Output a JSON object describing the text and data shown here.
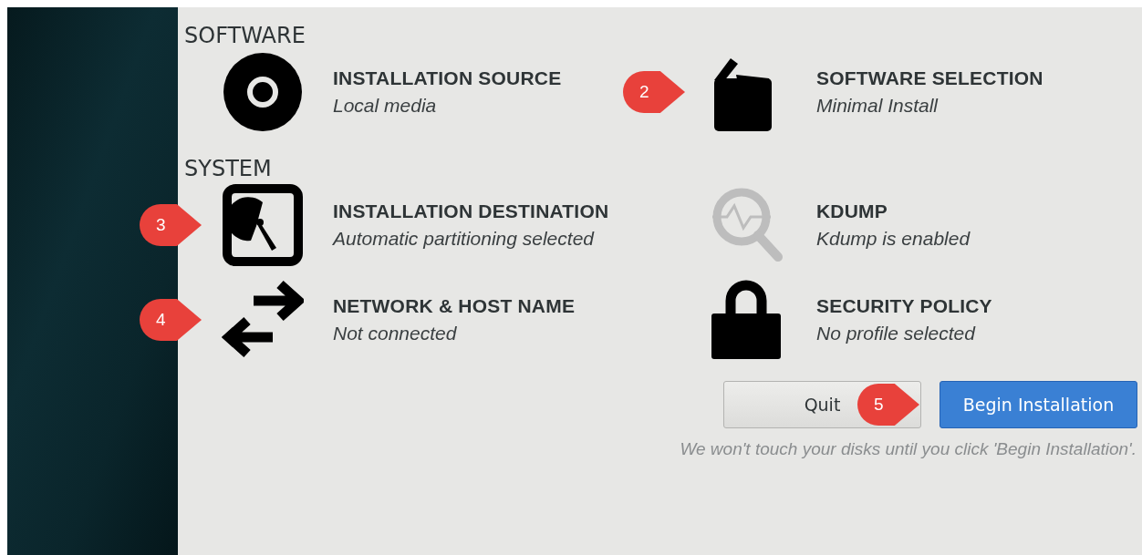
{
  "sections": [
    {
      "heading": "SOFTWARE",
      "spokes": [
        {
          "kind": "disc",
          "title": "INSTALLATION SOURCE",
          "status": "Local media",
          "dimmed": false
        },
        {
          "kind": "package",
          "title": "SOFTWARE SELECTION",
          "status": "Minimal Install",
          "dimmed": false,
          "callout": "2"
        }
      ]
    },
    {
      "heading": "SYSTEM",
      "spokes": [
        {
          "kind": "disk",
          "title": "INSTALLATION DESTINATION",
          "status": "Automatic partitioning selected",
          "dimmed": false,
          "callout": "3"
        },
        {
          "kind": "search",
          "title": "KDUMP",
          "status": "Kdump is enabled",
          "dimmed": true
        },
        {
          "kind": "network",
          "title": "NETWORK & HOST NAME",
          "status": "Not connected",
          "dimmed": false,
          "callout": "4"
        },
        {
          "kind": "lock",
          "title": "SECURITY POLICY",
          "status": "No profile selected",
          "dimmed": false
        }
      ]
    }
  ],
  "buttons": [
    {
      "label": "Quit",
      "primary": false
    },
    {
      "label": "Begin Installation",
      "primary": true,
      "callout": "5"
    }
  ],
  "note": "We won't touch your disks until you click 'Begin Installation'."
}
